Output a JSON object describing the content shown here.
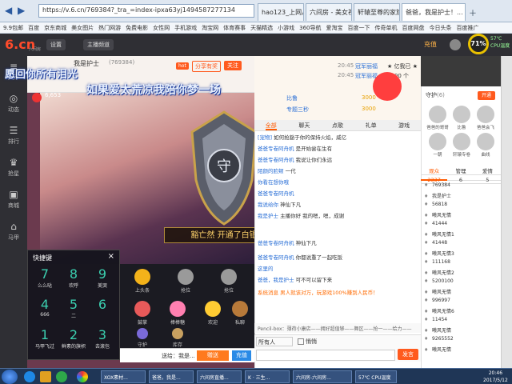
{
  "browser": {
    "url": "https://v.6.cn/769384?_tra_=index-ipxa63yj1494587277134",
    "tabs": [
      "hao123_上网从这...",
      "六间房 - 美女视...",
      "轩辕至尊的家族主..."
    ],
    "active_tab": "爸爸，我是护士！...",
    "bookmarks": [
      "9.9包邮",
      "百度",
      "京东商城",
      "美女图片",
      "热门网游",
      "免费电影",
      "女性网",
      "手机游戏",
      "淘宝网",
      "体育赛事",
      "天猫精选",
      "小游戏",
      "360导航",
      "爱淘宝",
      "百度一下",
      "传奇单机",
      "百度网盘",
      "今日头条",
      "百度推广"
    ]
  },
  "site": {
    "logo_text": "6.cn",
    "logo_sub": "六间房",
    "btn_settings": "设置",
    "btn_main_channel": "主播频道",
    "user_label": "充值",
    "temp": "71%",
    "cpu_line1": "57℃",
    "cpu_line2": "CPU温度"
  },
  "leftnav": [
    {
      "icon": "≡",
      "label": "大厅"
    },
    {
      "icon": "◎",
      "label": "动态"
    },
    {
      "icon": "☰",
      "label": "排行"
    },
    {
      "icon": "♛",
      "label": "抢星"
    },
    {
      "icon": "▣",
      "label": "商城"
    },
    {
      "icon": "⌂",
      "label": "马甲"
    }
  ],
  "anchor": {
    "name": "我是护士",
    "room_id": "(769384)",
    "level_text": "6,653",
    "share_btn": "分享有奖",
    "follow_btn": "关注",
    "hot_tag": "hot"
  },
  "overlay": {
    "line1": "愿回你所有泪光",
    "line2": "如果爱太荒凉我陪你梦一场",
    "banner": "豁亡然 开通了白银守护！"
  },
  "quick": {
    "title": "快捷键",
    "close": "×",
    "keys": [
      {
        "num": "7",
        "label": "么么哒"
      },
      {
        "num": "8",
        "label": "欢呼"
      },
      {
        "num": "9",
        "label": "美哭"
      },
      {
        "num": "4",
        "label": "666"
      },
      {
        "num": "5",
        "label": "二"
      },
      {
        "num": "6",
        "label": ""
      },
      {
        "num": "1",
        "label": "马甲飞过"
      },
      {
        "num": "2",
        "label": "鲜素的旗帜"
      },
      {
        "num": "3",
        "label": "去滚包"
      }
    ]
  },
  "gifts": [
    {
      "label": "上头条",
      "color": "#f3b21a"
    },
    {
      "label": "抢位",
      "color": "#9a9a9a"
    },
    {
      "label": "抢位",
      "color": "#9a9a9a"
    },
    {
      "label": "鼓掌",
      "color": "#e85a5a"
    },
    {
      "label": "棒棒糖",
      "color": "#ff7fb0"
    },
    {
      "label": "欢迎",
      "color": "#ffcc33"
    },
    {
      "label": "私聊",
      "color": "#b87a3a"
    },
    {
      "label": "守护",
      "color": "#7a6ad8"
    },
    {
      "label": "库存",
      "color": "#c8a060"
    }
  ],
  "sendbar": {
    "to_label": "送给：我是...",
    "gift_btn": "赠送",
    "charge_btn": "充值"
  },
  "chat": {
    "top_msgs": [
      {
        "time": "20:45",
        "user": "冠军丽福",
        "text": "★ 亿我已 ★ "
      },
      {
        "time": "20:45",
        "user": "冠军丽福",
        "text": "5200 个 "
      },
      {
        "time": "",
        "user": "比鲁",
        "text": "3000"
      },
      {
        "time": "",
        "user": "专题三秒",
        "text": "3000"
      }
    ],
    "tabs": [
      "全部",
      "聊天",
      "点歌",
      "礼单",
      "游戏"
    ],
    "messages": [
      {
        "user": "[宠物]",
        "text": "如何抢豁于你的保持火焰，威亿"
      },
      {
        "user": "爸爸专卷阿舟机",
        "text": "是开始尝在生有"
      },
      {
        "user": "爸爸专卷阿舟机",
        "text": "我说让你们永远"
      },
      {
        "user": "陌颜的脸颊",
        "text": "一代"
      },
      {
        "user": "你看在想你哦",
        "text": ""
      },
      {
        "user": "爸爸专卷阿舟机",
        "text": ""
      },
      {
        "user": "我说给你",
        "text": "神仙下凡"
      },
      {
        "user": "我是护士",
        "text": "主播你好 我的嗯，嗯，成谢"
      },
      {
        "user": "爸爸专卷阿舟机",
        "text": "神仙下凡"
      },
      {
        "user": "爸爸专卷阿舟机",
        "text": "你都说重了一起吃饭"
      },
      {
        "user": "这里的",
        "text": ""
      },
      {
        "user": "爸爸，我是护士",
        "text": "可不可以留下来"
      },
      {
        "user": "系统消息",
        "text": "男人就该对万，玩游戏100%赚到人民币！"
      }
    ],
    "ad_line": "Pencil-box：薄荷小康店——拥好超值够——舞区——抢一——给力——",
    "input_select": "所有人",
    "input_checkbox": "悄悄",
    "send_btn": "发言"
  },
  "right": {
    "guard_title": "守护",
    "guard_count": "(6)",
    "guard_btn": "开通",
    "guards": [
      "爸爸的哥哥",
      "比鲁",
      "爸爸会飞",
      "一朝",
      "轩辕专卷",
      "曲线"
    ],
    "tabs": [
      {
        "label": "观众",
        "count": "2337"
      },
      {
        "label": "管理",
        "count": "6"
      },
      {
        "label": "爱情",
        "count": "5"
      }
    ],
    "ranks": [
      {
        "id": "769384",
        "name": ""
      },
      {
        "id": "",
        "name": "我是护士"
      },
      {
        "id": "56818",
        "name": ""
      },
      {
        "id": "",
        "name": "曦风无情"
      },
      {
        "id": "41444",
        "name": ""
      },
      {
        "id": "",
        "name": "曦风无情1"
      },
      {
        "id": "41448",
        "name": ""
      },
      {
        "id": "",
        "name": "曦风无情3"
      },
      {
        "id": "111168",
        "name": ""
      },
      {
        "id": "",
        "name": "曦风无情2"
      },
      {
        "id": "5200100",
        "name": ""
      },
      {
        "id": "",
        "name": "曦风无情"
      },
      {
        "id": "996997",
        "name": ""
      },
      {
        "id": "",
        "name": "曦风无情6"
      },
      {
        "id": "11454",
        "name": ""
      },
      {
        "id": "",
        "name": "曦风无情"
      },
      {
        "id": "9265552",
        "name": ""
      },
      {
        "id": "",
        "name": "曦风无情"
      }
    ]
  },
  "taskbar": {
    "items": [
      "XOX素材...",
      "爸爸，我是...",
      "六间房直播...",
      "K · 三生...",
      "六间房-六间房...",
      "57℃ CPU温度"
    ],
    "time": "20:46",
    "date": "2017/5/12"
  }
}
